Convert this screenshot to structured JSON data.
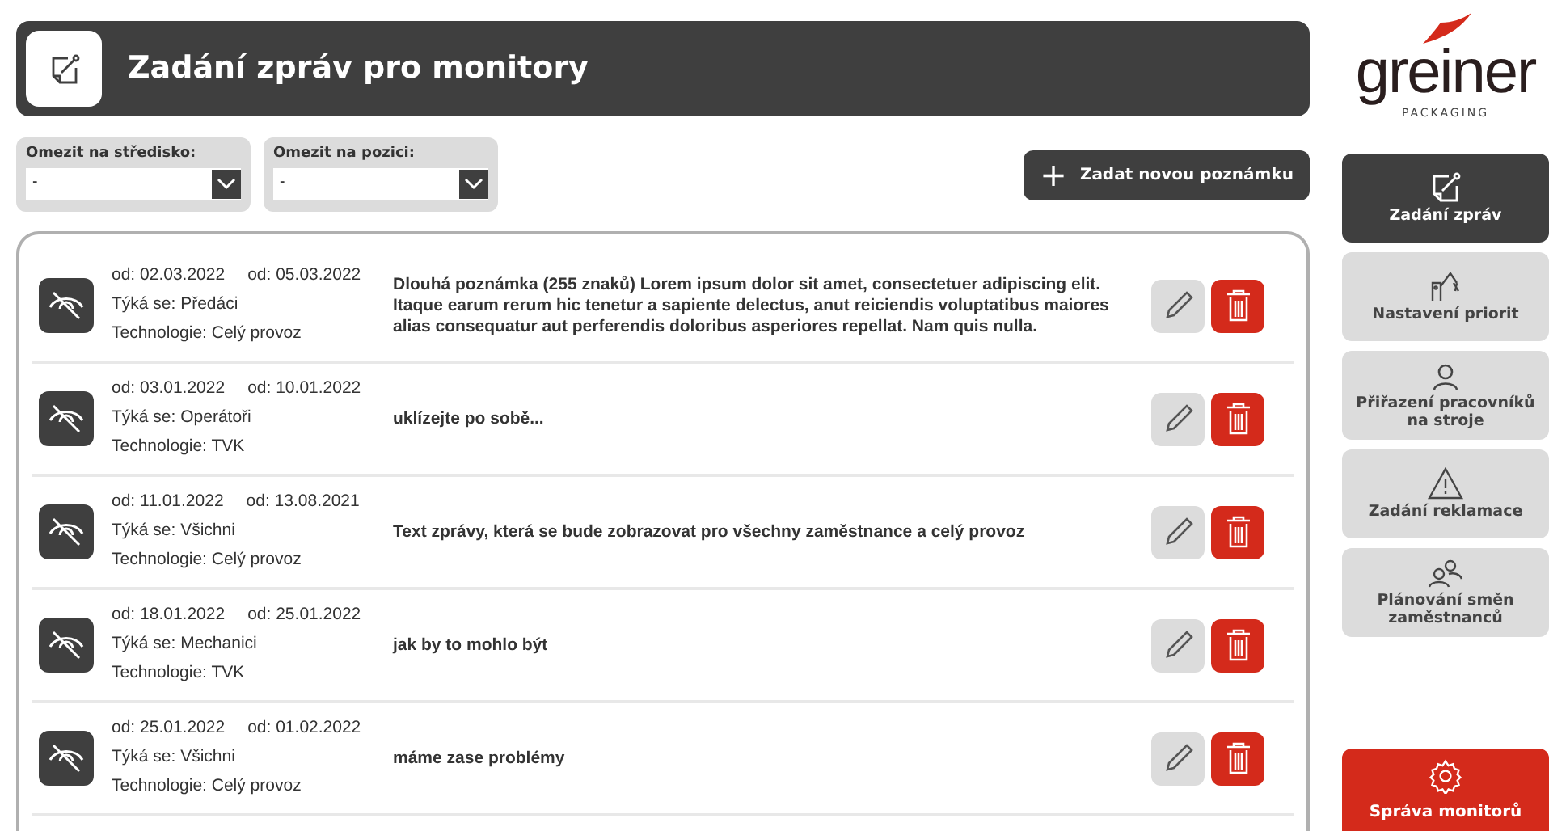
{
  "header": {
    "title": "Zadání zpráv pro monitory"
  },
  "logo": {
    "name": "greiner",
    "tagline": "PACKAGING"
  },
  "filters": [
    {
      "label": "Omezit na středisko:",
      "value": "-"
    },
    {
      "label": "Omezit na pozici:",
      "value": "-"
    }
  ],
  "add_button": {
    "icon": "+",
    "label": "Zadat novou poznámku"
  },
  "messages": [
    {
      "from": "od: 02.03.2022",
      "to": "od: 05.03.2022",
      "audience": "Týká se: Předáci",
      "technology": "Technologie: Celý provoz",
      "text": "Dlouhá poznámka (255 znaků) Lorem ipsum dolor sit amet, consectetuer adipiscing elit. Itaque earum rerum hic tenetur a sapiente delectus, anut reiciendis voluptatibus maiores alias consequatur aut perferendis doloribus asperiores repellat. Nam quis nulla."
    },
    {
      "from": "od: 03.01.2022",
      "to": "od: 10.01.2022",
      "audience": "Týká se: Operátoři",
      "technology": "Technologie: TVK",
      "text": "uklízejte po sobě..."
    },
    {
      "from": "od: 11.01.2022",
      "to": "od: 13.08.2021",
      "audience": "Týká se: Všichni",
      "technology": "Technologie: Celý provoz",
      "text": "Text zprávy, která se bude zobrazovat pro všechny zaměstnance a celý provoz"
    },
    {
      "from": "od: 18.01.2022",
      "to": "od: 25.01.2022",
      "audience": "Týká se: Mechanici",
      "technology": "Technologie: TVK",
      "text": "jak by to mohlo být"
    },
    {
      "from": "od: 25.01.2022",
      "to": "od: 01.02.2022",
      "audience": "Týká se: Všichni",
      "technology": "Technologie: Celý provoz",
      "text": "máme zase problémy"
    }
  ],
  "sidebar": {
    "items": [
      {
        "kind": "note",
        "label": "Zadání zpráv",
        "selected": true
      },
      {
        "kind": "robot",
        "label": "Nastavení priorit",
        "selected": false
      },
      {
        "kind": "person",
        "label": "Přiřazení pracovníků na stroje",
        "selected": false
      },
      {
        "kind": "warning",
        "label": "Zadání reklamace",
        "selected": false
      },
      {
        "kind": "people",
        "label": "Plánování směn zaměstnanců",
        "selected": false
      }
    ],
    "settings_button": {
      "label": "Správa monitorů"
    }
  }
}
